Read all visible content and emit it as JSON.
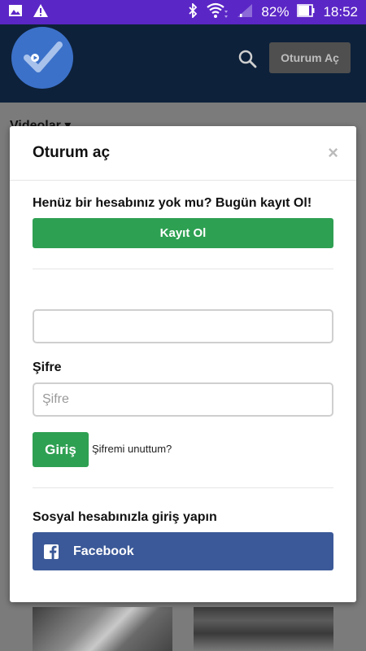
{
  "statusbar": {
    "battery": "82%",
    "time": "18:52",
    "icons": [
      "image-icon",
      "warning-icon",
      "bluetooth-icon",
      "wifi-icon",
      "signal-icon",
      "battery-icon"
    ]
  },
  "header": {
    "login_button": "Oturum Aç"
  },
  "page": {
    "section_title": "Videolar ▾"
  },
  "modal": {
    "title": "Oturum aç",
    "close": "×",
    "signup_prompt": "Henüz bir hesabınız yok mu? Bugün kayıt Ol!",
    "signup_button": "Kayıt Ol",
    "username_value": "",
    "password_label": "Şifre",
    "password_placeholder": "Şifre",
    "login_button": "Giriş",
    "forgot_link": "Şifremi unuttum?",
    "social_prompt": "Sosyal hesabınızla giriş yapın",
    "facebook_button": "Facebook"
  },
  "colors": {
    "statusbar": "#5b26c6",
    "header": "#0d213a",
    "logo": "#3c71c9",
    "green": "#2ea052",
    "facebook": "#3b5998"
  }
}
